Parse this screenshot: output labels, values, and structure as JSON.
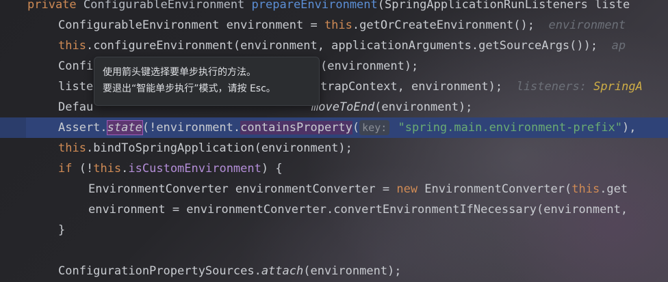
{
  "tooltip": {
    "line1": "使用箭头键选择要单步执行的方法。",
    "line2": "要退出“智能单步执行”模式，请按 Esc。"
  },
  "code": {
    "l1": {
      "kw": "private ",
      "type": "ConfigurableEnvironment ",
      "fn": "prepareEnvironment",
      "rest": "(SpringApplicationRunListeners liste"
    },
    "l2": {
      "a": "ConfigurableEnvironment environment = ",
      "kw": "this",
      "b": ".getOrCreateEnvironment();",
      "hint": "  environment"
    },
    "l3": {
      "kw": "this",
      "a": ".configureEnvironment(environment, applicationArguments.getSourceArgs());",
      "hint": "  ap"
    },
    "l4": {
      "a": "Confi",
      "b": "(environment);"
    },
    "l5": {
      "a": "liste",
      "b": "trapContext, environment);",
      "hint": "  listeners: ",
      "hint_type": "SpringA"
    },
    "l6": {
      "a": "Defau",
      "b": "moveToEnd",
      "c": "(environment);"
    },
    "l7": {
      "a": "Assert.",
      "sel": "state",
      "b": "(!environment.",
      "c": "containsProperty",
      "d": "(",
      "param": "key:",
      "str": " \"spring.main.environment-prefix\"",
      "e": "),"
    },
    "l8": {
      "kw": "this",
      "a": ".bindToSpringApplication(environment);"
    },
    "l9": {
      "kw": "if",
      "a": " (!",
      "kw2": "this",
      "b": ".",
      "fld": "isCustomEnvironment",
      "c": ") {"
    },
    "l10": {
      "a": "EnvironmentConverter environmentConverter = ",
      "kw": "new",
      "b": " EnvironmentConverter(",
      "kw2": "this",
      "c": ".get"
    },
    "l11": {
      "a": "environment = environmentConverter.convertEnvironmentIfNecessary(environment,"
    },
    "l12": {
      "a": "}"
    },
    "l14": {
      "a": "ConfigurationPropertySources.",
      "b": "attach",
      "c": "(environment);"
    }
  }
}
